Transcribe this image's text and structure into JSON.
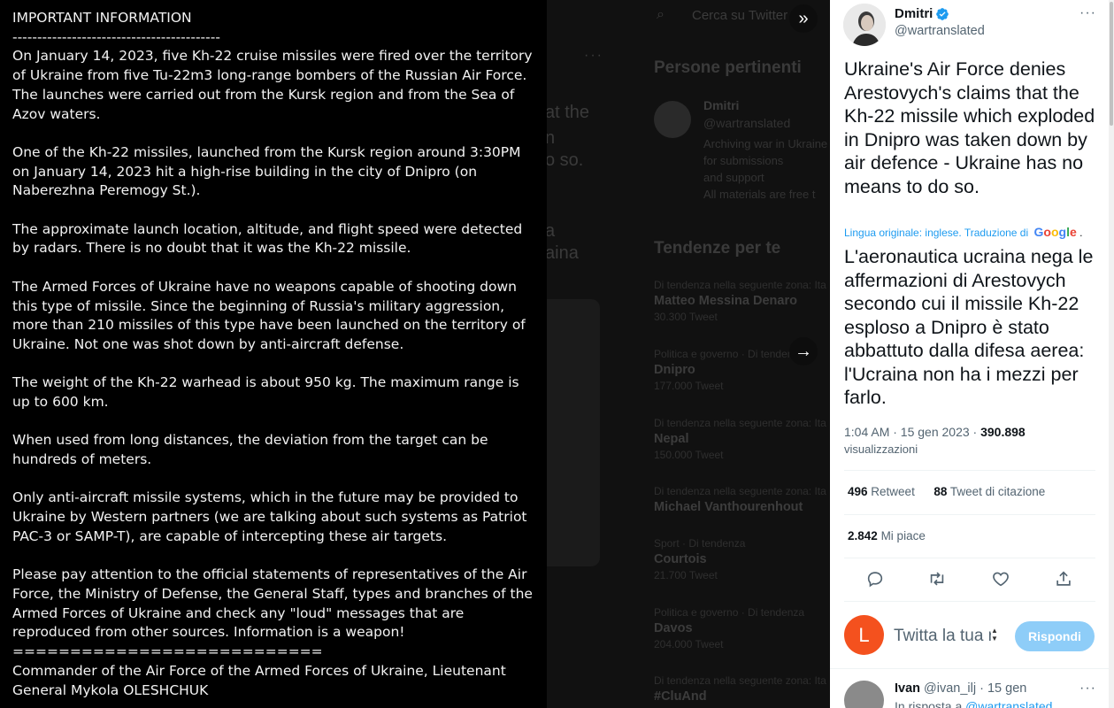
{
  "image_panel": {
    "title": "IMPORTANT INFORMATION",
    "separator_top": "------------------------------------------",
    "paragraphs": [
      "On January 14, 2023, five Kh-22 cruise missiles were fired over the territory of Ukraine from five Tu-22m3 long-range bombers of the Russian Air Force. The launches were carried out from the Kursk region and from the Sea of Azov waters.",
      "One of the Kh-22 missiles, launched from the Kursk region around 3:30PM on January 14, 2023 hit a high-rise building in the city of Dnipro (on Naberezhna Peremogy St.).",
      "The approximate launch location, altitude, and flight speed were detected by radars. There is no doubt that it was the Kh-22 missile.",
      "The Armed Forces of Ukraine have no weapons capable of shooting down this type of missile. Since the beginning of Russia's military aggression, more than 210 missiles of this type have been launched on the territory of Ukraine. Not one was shot down by anti-aircraft defense.",
      "The weight of the Kh-22 warhead is about 950 kg. The maximum range is up to 600 km.",
      "When used from long distances, the deviation from the target can be hundreds of meters.",
      "Only anti-aircraft missile systems, which in the future may be provided to Ukraine by Western partners (we are talking about such systems as Patriot PAC-3 or SAMP-T), are capable of intercepting these air targets.",
      "Please pay attention to the official statements of representatives of the Air Force, the Ministry of Defense, the General Staff, types and branches of the Armed Forces of Ukraine and check any \"loud\" messages that are reproduced from other sources. Information is a weapon!"
    ],
    "separator_bottom": "===========================",
    "signature": "Commander of the Air Force of the Armed Forces of Ukraine, Lieutenant General Mykola OLESHCHUK"
  },
  "background": {
    "search_placeholder": "Cerca su Twitter",
    "more_dots": "···",
    "fragments": [
      "at the",
      "n",
      "o so.",
      "a",
      "aina"
    ],
    "related_title": "Persone pertinenti",
    "related_user": {
      "name": "Dmitri",
      "handle": "@wartranslated",
      "bio_lines": [
        "Archiving war in Ukraine",
        "for submissions",
        "and support",
        "All materials are free t"
      ]
    },
    "trends_title": "Tendenze per te",
    "trends": [
      {
        "category": "Di tendenza nella seguente zona: Ita",
        "topic": "Matteo Messina Denaro",
        "count": "30.300 Tweet"
      },
      {
        "category": "Politica e governo · Di tendenza",
        "topic": "Dnipro",
        "count": "177.000 Tweet"
      },
      {
        "category": "Di tendenza nella seguente zona: Ita",
        "topic": "Nepal",
        "count": "150.000 Tweet"
      },
      {
        "category": "Di tendenza nella seguente zona: Ita",
        "topic": "Michael Vanthourenhout",
        "count": ""
      },
      {
        "category": "Sport · Di tendenza",
        "topic": "Courtois",
        "count": "21.700 Tweet"
      },
      {
        "category": "Politica e governo · Di tendenza",
        "topic": "Davos",
        "count": "204.000 Tweet"
      },
      {
        "category": "Di tendenza nella seguente zona: Ita",
        "topic": "#CluAnd",
        "count": ""
      }
    ]
  },
  "controls": {
    "collapse_icon": "»",
    "next_icon": "→"
  },
  "tweet": {
    "author_name": "Dmitri",
    "author_handle": "@wartranslated",
    "more_icon": "···",
    "text_original": "Ukraine's Air Force denies Arestovych's claims that the Kh-22 missile which exploded in Dnipro was taken down by air defence - Ukraine has no means to do so.",
    "translation_note": "Lingua originale: inglese. Traduzione di",
    "translation_suffix": ".",
    "google_letters": [
      "G",
      "o",
      "o",
      "g",
      "l",
      "e"
    ],
    "text_translated": "L'aeronautica ucraina nega le affermazioni di Arestovych secondo cui il missile Kh-22 esploso a Dnipro è stato abbattuto dalla difesa aerea: l'Ucraina non ha i mezzi per farlo.",
    "timestamp": "1:04 AM · 15 gen 2023 · ",
    "views_count": "390.898",
    "views_label": "visualizzazioni",
    "retweets_count": "496",
    "retweets_label": "Retweet",
    "quotes_count": "88",
    "quotes_label": "Tweet di citazione",
    "likes_count": "2.842",
    "likes_label": "Mi piace",
    "accent": "#1d9bf0"
  },
  "reply_box": {
    "avatar_letter": "L",
    "placeholder": "Twitta la tua risposta!",
    "button_label": "Rispondi",
    "avatar_color": "#f4511e"
  },
  "reply": {
    "author_name": "Ivan",
    "author_handle": "@ivan_ilj",
    "date": "· 15 gen",
    "more_icon": "···",
    "context_prefix": "In risposta a",
    "context_handle": "@wartranslated"
  }
}
